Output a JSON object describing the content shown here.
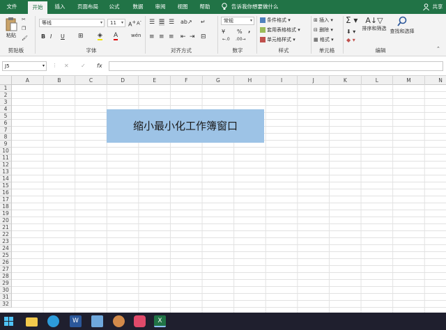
{
  "tabs": [
    {
      "label": "文件",
      "name": "tab-file"
    },
    {
      "label": "开始",
      "name": "tab-home",
      "active": true
    },
    {
      "label": "插入",
      "name": "tab-insert"
    },
    {
      "label": "页面布局",
      "name": "tab-page-layout"
    },
    {
      "label": "公式",
      "name": "tab-formulas"
    },
    {
      "label": "数据",
      "name": "tab-data"
    },
    {
      "label": "审阅",
      "name": "tab-review"
    },
    {
      "label": "视图",
      "name": "tab-view"
    },
    {
      "label": "帮助",
      "name": "tab-help"
    }
  ],
  "tell_me": "告诉我你想要做什么",
  "share": "共享",
  "ribbon": {
    "paste": "粘贴",
    "clipboard": "剪贴板",
    "font_group": "字体",
    "font_name": "等线",
    "font_size": "11",
    "align_group": "对齐方式",
    "number_format": "常规",
    "number_group": "数字",
    "cond_format": "条件格式",
    "table_format": "套用表格格式",
    "cell_style": "单元格样式",
    "styles_group": "样式",
    "insert": "插入",
    "delete": "删除",
    "format": "格式",
    "cells_group": "单元格",
    "sort_filter": "排序和筛选",
    "find_select": "查找和选择",
    "edit_group": "编辑",
    "bold": "B",
    "italic": "I",
    "underline": "U",
    "fx": "fx",
    "percent": "%",
    "comma": ","
  },
  "name_box": "J5",
  "columns": [
    "A",
    "B",
    "C",
    "D",
    "E",
    "F",
    "G",
    "H",
    "I",
    "J",
    "K",
    "L",
    "M",
    "N"
  ],
  "rows": [
    "1",
    "2",
    "3",
    "4",
    "5",
    "6",
    "7",
    "8",
    "9",
    "10",
    "11",
    "12",
    "13",
    "14",
    "15",
    "16",
    "17",
    "18",
    "19",
    "20",
    "21",
    "22",
    "23",
    "24",
    "25",
    "26",
    "27",
    "28",
    "29",
    "30",
    "31",
    "32"
  ],
  "banner_text": "缩小最小化工作簿窗口",
  "colors": {
    "brand": "#217346",
    "banner": "#9dc3e6"
  }
}
